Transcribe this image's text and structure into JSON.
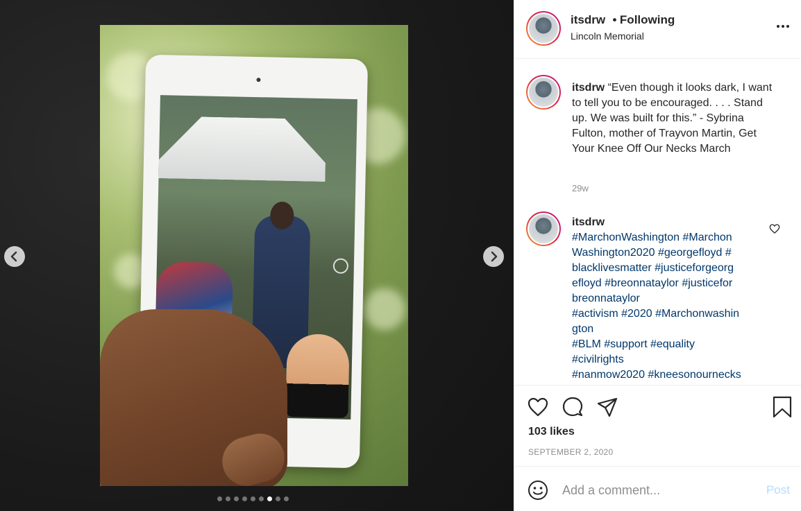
{
  "post": {
    "username": "itsdrw",
    "separator": "•",
    "follow_state": "Following",
    "location": "Lincoln Memorial",
    "more_icon": "more-options-icon"
  },
  "media": {
    "carousel_total": 9,
    "carousel_active_index": 6,
    "prev_icon": "chevron-left-icon",
    "next_icon": "chevron-right-icon"
  },
  "caption": {
    "username": "itsdrw",
    "text": "“Even though it looks dark, I want to tell you to be encouraged. . . . Stand up. We was built for this.” - Sybrina Fulton, mother of Trayvon Martin, Get Your Knee Off Our Necks March",
    "time": "29w"
  },
  "comment": {
    "username": "itsdrw",
    "lines": [
      "#MarchonWashington #Marchon",
      "Washington2020 #georgefloyd #",
      "blacklivesmatter  #justiceforgeorg",
      "efloyd #breonnataylor #justicefor",
      "breonnataylor",
      "#activism #2020 #Marchonwashin",
      "gton",
      "#BLM #support #equality",
      "#civilrights",
      "#nanmow2020 #kneesonournecks"
    ]
  },
  "actions": {
    "likes": "103 likes",
    "date": "SEPTEMBER 2, 2020"
  },
  "add_comment": {
    "placeholder": "Add a comment...",
    "post_label": "Post"
  },
  "colors": {
    "hashtag": "#00376b",
    "post_disabled": "#b3dbff",
    "secondary_text": "#8e8e8e"
  }
}
